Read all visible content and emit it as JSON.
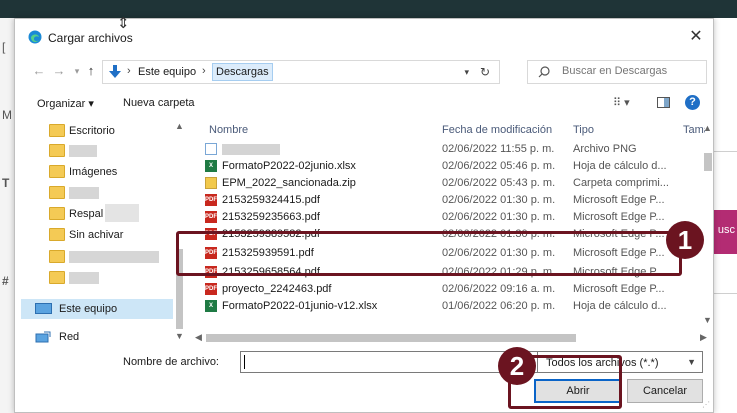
{
  "dialog": {
    "title": "Cargar archivos",
    "close": "✕",
    "nav": {
      "back": "←",
      "forward": "→",
      "recent": "▾",
      "up": "↑"
    },
    "address": {
      "crumb1": "Este equipo",
      "crumb2": "Descargas",
      "sep": "›",
      "dropdown": "▾",
      "refresh": "↻"
    },
    "search": {
      "placeholder": "Buscar en Descargas"
    },
    "toolbar": {
      "organize": "Organizar ▾",
      "new_folder": "Nueva carpeta",
      "view": "⠿ ▾",
      "help": "?"
    },
    "sidebar": {
      "items": [
        {
          "label": "Escritorio"
        },
        {
          "label": ""
        },
        {
          "label": "Imágenes"
        },
        {
          "label": ""
        },
        {
          "label": "Respal"
        },
        {
          "label": "Sin achivar"
        },
        {
          "label": ""
        },
        {
          "label": ""
        },
        {
          "label": "Este equipo"
        },
        {
          "label": "Red"
        }
      ]
    },
    "columns": {
      "name": "Nombre",
      "date": "Fecha de modificación",
      "type": "Tipo",
      "size": "Tamaño"
    },
    "files": [
      {
        "icon": "image",
        "name": "",
        "date": "02/06/2022 11:55 p. m.",
        "type": "Archivo PNG"
      },
      {
        "icon": "excel",
        "name": "FormatoP2022-02junio.xlsx",
        "date": "02/06/2022 05:46 p. m.",
        "type": "Hoja de cálculo d..."
      },
      {
        "icon": "zip",
        "name": "EPM_2022_sancionada.zip",
        "date": "02/06/2022 05:43 p. m.",
        "type": "Carpeta comprimi..."
      },
      {
        "icon": "pdf",
        "name": "2153259324415.pdf",
        "date": "02/06/2022 01:30 p. m.",
        "type": "Microsoft Edge P..."
      },
      {
        "icon": "pdf",
        "name": "2153259235663.pdf",
        "date": "02/06/2022 01:30 p. m.",
        "type": "Microsoft Edge P..."
      },
      {
        "icon": "pdf",
        "name": "2153259389582.pdf",
        "date": "02/06/2022 01:30 p. m.",
        "type": "Microsoft Edge P..."
      },
      {
        "icon": "pdf",
        "name": "215325939591.pdf",
        "date": "02/06/2022 01:30 p. m.",
        "type": "Microsoft Edge P..."
      },
      {
        "icon": "pdf",
        "name": "2153259658564.pdf",
        "date": "02/06/2022 01:29 p. m.",
        "type": "Microsoft Edge P..."
      },
      {
        "icon": "pdf",
        "name": "proyecto_2242463.pdf",
        "date": "02/06/2022 09:16 a. m.",
        "type": "Microsoft Edge P..."
      },
      {
        "icon": "excel",
        "name": "FormatoP2022-01junio-v12.xlsx",
        "date": "01/06/2022 06:20 p. m.",
        "type": "Hoja de cálculo d..."
      }
    ],
    "filename_label": "Nombre de archivo:",
    "filename_value": "",
    "filetype": "Todos los archivos (*.*)",
    "open": "Abrir",
    "cancel": "Cancelar"
  },
  "annotations": {
    "step1": "1",
    "step2": "2"
  },
  "background": {
    "right_button_fragment": "usc",
    "left_fragments": [
      "[",
      "M",
      "T",
      "#"
    ]
  },
  "colors": {
    "annotation": "#6b1420",
    "selection": "#cde6f7",
    "primary_border": "#0a64c8"
  }
}
